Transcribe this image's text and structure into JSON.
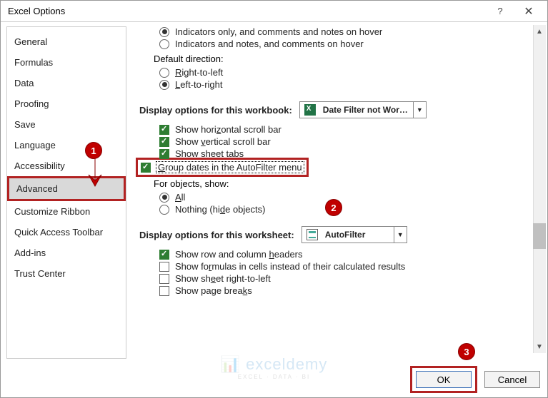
{
  "title": "Excel Options",
  "sidebar": {
    "items": [
      {
        "label": "General"
      },
      {
        "label": "Formulas"
      },
      {
        "label": "Data"
      },
      {
        "label": "Proofing"
      },
      {
        "label": "Save"
      },
      {
        "label": "Language"
      },
      {
        "label": "Accessibility"
      },
      {
        "label": "Advanced",
        "selected": true
      },
      {
        "label": "Customize Ribbon"
      },
      {
        "label": "Quick Access Toolbar"
      },
      {
        "label": "Add-ins"
      },
      {
        "label": "Trust Center"
      }
    ]
  },
  "content": {
    "radio_indicators_hover": "Indicators only, and comments and notes on hover",
    "radio_indicators_notes": "Indicators and notes, and comments on hover",
    "default_direction_label": "Default direction:",
    "radio_rtl": "Right-to-left",
    "radio_ltr": "Left-to-right",
    "section_workbook": "Display options for this workbook:",
    "workbook_selected": "Date Filter not Wor…",
    "chk_hscroll": "Show horizontal scroll bar",
    "chk_vscroll": "Show vertical scroll bar",
    "chk_tabs": "Show sheet tabs",
    "chk_group_dates": "Group dates in the AutoFilter menu",
    "for_objects_label": "For objects, show:",
    "radio_all": "All",
    "radio_nothing": "Nothing (hide objects)",
    "section_worksheet": "Display options for this worksheet:",
    "worksheet_selected": "AutoFilter",
    "chk_rowcol": "Show row and column headers",
    "chk_formulas": "Show formulas in cells instead of their calculated results",
    "chk_sheet_rtl": "Show sheet right-to-left",
    "chk_pagebreaks": "Show page breaks"
  },
  "footer": {
    "ok": "OK",
    "cancel": "Cancel"
  },
  "callouts": {
    "c1": "1",
    "c2": "2",
    "c3": "3"
  }
}
